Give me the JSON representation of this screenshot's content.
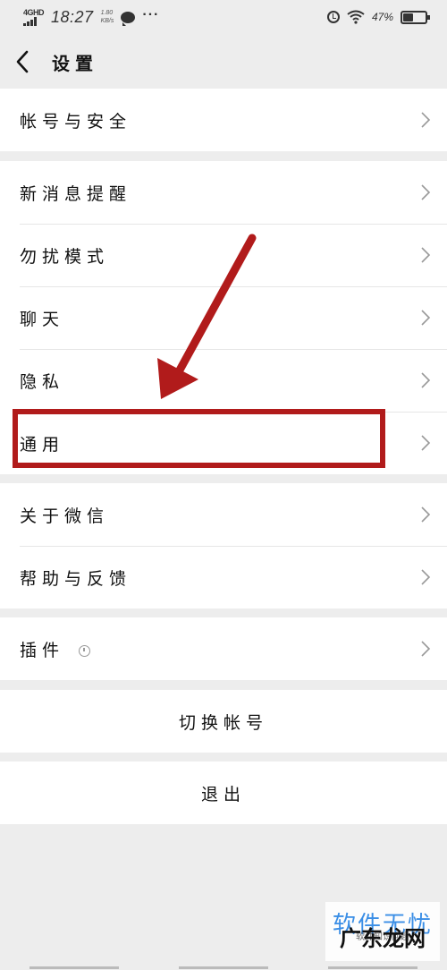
{
  "status_bar": {
    "network_type": "4GHD",
    "time": "18:27",
    "speed_value": "1.80",
    "speed_unit": "KB/s",
    "more": "···",
    "battery_percent": "47%"
  },
  "nav": {
    "title": "设置"
  },
  "sections": {
    "account": {
      "items": [
        {
          "label": "帐号与安全"
        }
      ]
    },
    "main": {
      "items": [
        {
          "label": "新消息提醒"
        },
        {
          "label": "勿扰模式"
        },
        {
          "label": "聊天"
        },
        {
          "label": "隐私"
        },
        {
          "label": "通用"
        }
      ]
    },
    "about": {
      "items": [
        {
          "label": "关于微信"
        },
        {
          "label": "帮助与反馈"
        }
      ]
    },
    "plugins": {
      "items": [
        {
          "label": "插件"
        }
      ]
    }
  },
  "actions": {
    "switch_account": "切换帐号",
    "logout": "退出"
  },
  "annotation": {
    "color": "#b11b1b"
  },
  "watermark": {
    "top": "软件无忧",
    "sub": "软件知识问题",
    "bottom": "广东龙网"
  }
}
